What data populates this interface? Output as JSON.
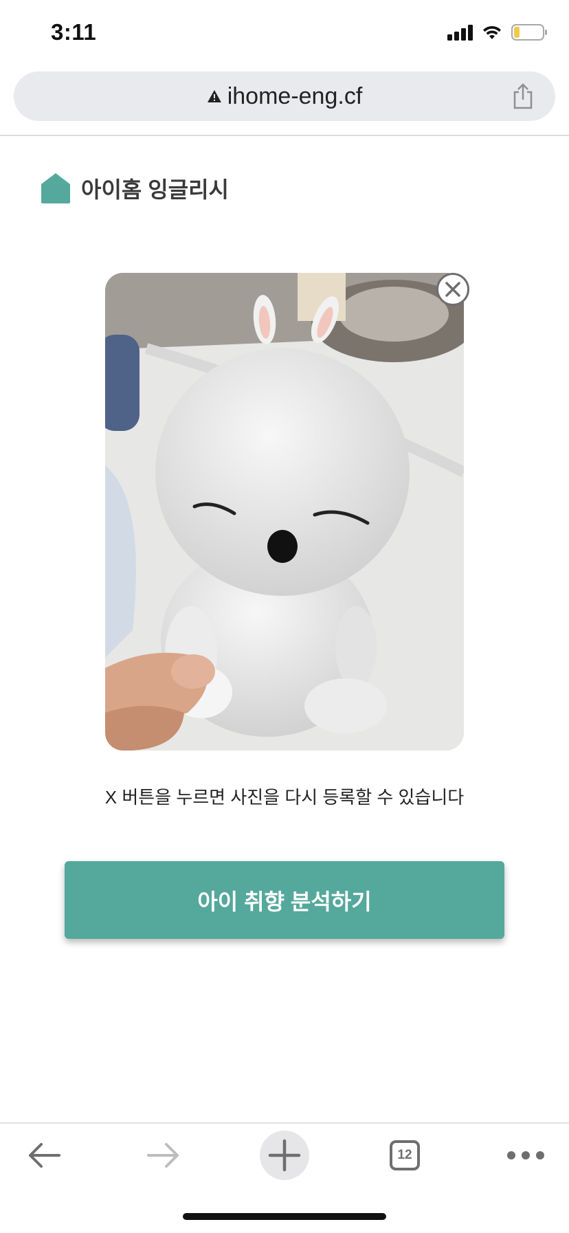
{
  "status_bar": {
    "time": "3:11",
    "icons": [
      "signal-icon",
      "wifi-icon",
      "battery-icon"
    ],
    "battery_color": "#f2c94c"
  },
  "browser": {
    "url": "ihome-eng.cf",
    "url_warning_icon": "warning-triangle-icon",
    "share_icon": "share-icon"
  },
  "brand": {
    "name": "아이홈 잉글리시",
    "logo_icon": "house-icon",
    "color": "#55a89c"
  },
  "photo": {
    "remove_icon": "close-circle-icon"
  },
  "hint_text": "X 버튼을 누르면 사진을 다시 등록할 수 있습니다",
  "cta": {
    "label": "아이 취향 분석하기",
    "color": "#55a89c"
  },
  "toolbar": {
    "back_icon": "back-arrow-icon",
    "forward_icon": "forward-arrow-icon",
    "new_tab_icon": "plus-icon",
    "tab_count": "12",
    "more_icon": "more-dots-icon"
  }
}
